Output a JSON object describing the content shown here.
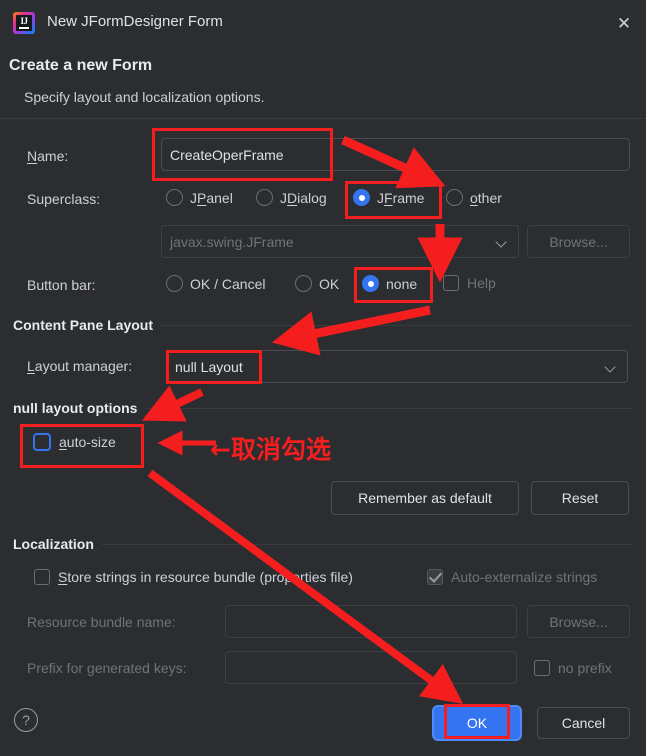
{
  "window": {
    "title": "New JFormDesigner Form",
    "app_icon": "intellij-idea-icon",
    "close_icon": "close-icon"
  },
  "header": {
    "title": "Create a new Form",
    "subtitle": "Specify layout and localization options."
  },
  "form": {
    "name_label": "Name:",
    "name_mnemonic": "N",
    "name_label_rest": "ame:",
    "name_value": "CreateOperFrame",
    "superclass_label": "Superclass:",
    "superclass_options": [
      {
        "label": "JPanel",
        "pre": "J",
        "mn": "P",
        "post": "anel",
        "selected": false
      },
      {
        "label": "JDialog",
        "pre": "J",
        "mn": "D",
        "post": "ialog",
        "selected": false
      },
      {
        "label": "JFrame",
        "pre": "J",
        "mn": "F",
        "post": "rame",
        "selected": true
      },
      {
        "label": "other",
        "pre": "",
        "mn": "o",
        "post": "ther",
        "selected": false
      }
    ],
    "superclass_combo_value": "javax.swing.JFrame",
    "superclass_browse_label": "Browse...",
    "buttonbar_label": "Button bar:",
    "buttonbar_options": [
      {
        "label": "OK / Cancel",
        "selected": false
      },
      {
        "label": "OK",
        "selected": false
      },
      {
        "label": "none",
        "selected": true
      }
    ],
    "help_checkbox_label": "Help",
    "help_checkbox_checked": false,
    "help_checkbox_disabled": true
  },
  "content_pane": {
    "section_title": "Content Pane Layout",
    "layout_manager_label": "Layout manager:",
    "layout_manager_mnemonic": "L",
    "layout_manager_label_rest": "ayout manager:",
    "layout_manager_value": "null Layout"
  },
  "null_layout": {
    "section_title": "null layout options",
    "auto_size_label": "auto-size",
    "auto_size_mnemonic": "a",
    "auto_size_label_rest": "uto-size",
    "auto_size_checked": false,
    "remember_label": "Remember as default",
    "reset_label": "Reset"
  },
  "localization": {
    "section_title": "Localization",
    "store_strings_label": "Store strings in resource bundle (properties file)",
    "store_strings_mnemonic": "S",
    "store_strings_label_rest": "tore strings in resource bundle (properties file)",
    "store_strings_checked": false,
    "auto_externalize_label": "Auto-externalize strings",
    "auto_externalize_checked": true,
    "resource_bundle_label": "Resource bundle name:",
    "resource_bundle_value": "",
    "resource_bundle_browse_label": "Browse...",
    "prefix_label": "Prefix for generated keys:",
    "prefix_value": "",
    "no_prefix_label": "no prefix",
    "no_prefix_checked": false
  },
  "footer": {
    "help_icon": "question-mark-icon",
    "ok_label": "OK",
    "cancel_label": "Cancel"
  },
  "annotations": {
    "chinese_note": "←取消勾选",
    "highlight_color": "#f41e1e",
    "boxes": [
      "name-field-box",
      "jframe-radio-box",
      "none-radio-box",
      "null-layout-value-box",
      "auto-size-box",
      "ok-button-box"
    ]
  }
}
